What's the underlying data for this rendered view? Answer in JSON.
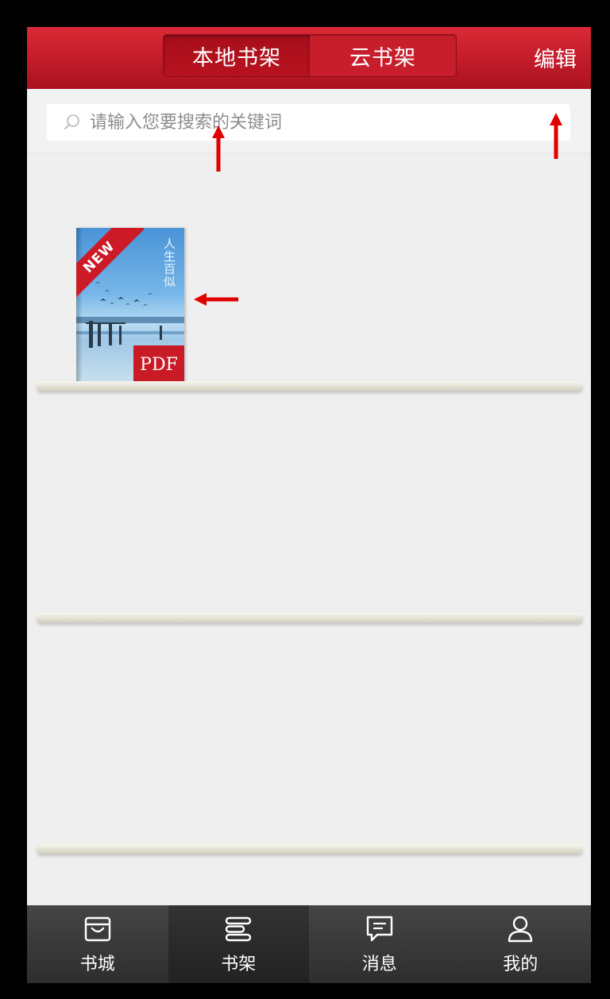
{
  "header": {
    "tabs": [
      {
        "label": "本地书架",
        "active": true
      },
      {
        "label": "云书架",
        "active": false
      }
    ],
    "edit_label": "编辑"
  },
  "search": {
    "placeholder": "请输入您要搜索的关键词",
    "icon": "search-icon"
  },
  "bookshelf": {
    "books": [
      {
        "cover_title": "人生百似",
        "new_badge": "NEW",
        "format_badge": "PDF"
      }
    ],
    "shelf_count": 3
  },
  "tabbar": {
    "items": [
      {
        "label": "书城",
        "icon": "store-icon",
        "active": false
      },
      {
        "label": "书架",
        "icon": "bookshelf-icon",
        "active": true
      },
      {
        "label": "消息",
        "icon": "message-icon",
        "active": false
      },
      {
        "label": "我的",
        "icon": "profile-icon",
        "active": false
      }
    ]
  },
  "colors": {
    "brand_red": "#c81e2c",
    "annotation_arrow": "#e00000",
    "tabbar_bg": "#3b3b3b"
  }
}
